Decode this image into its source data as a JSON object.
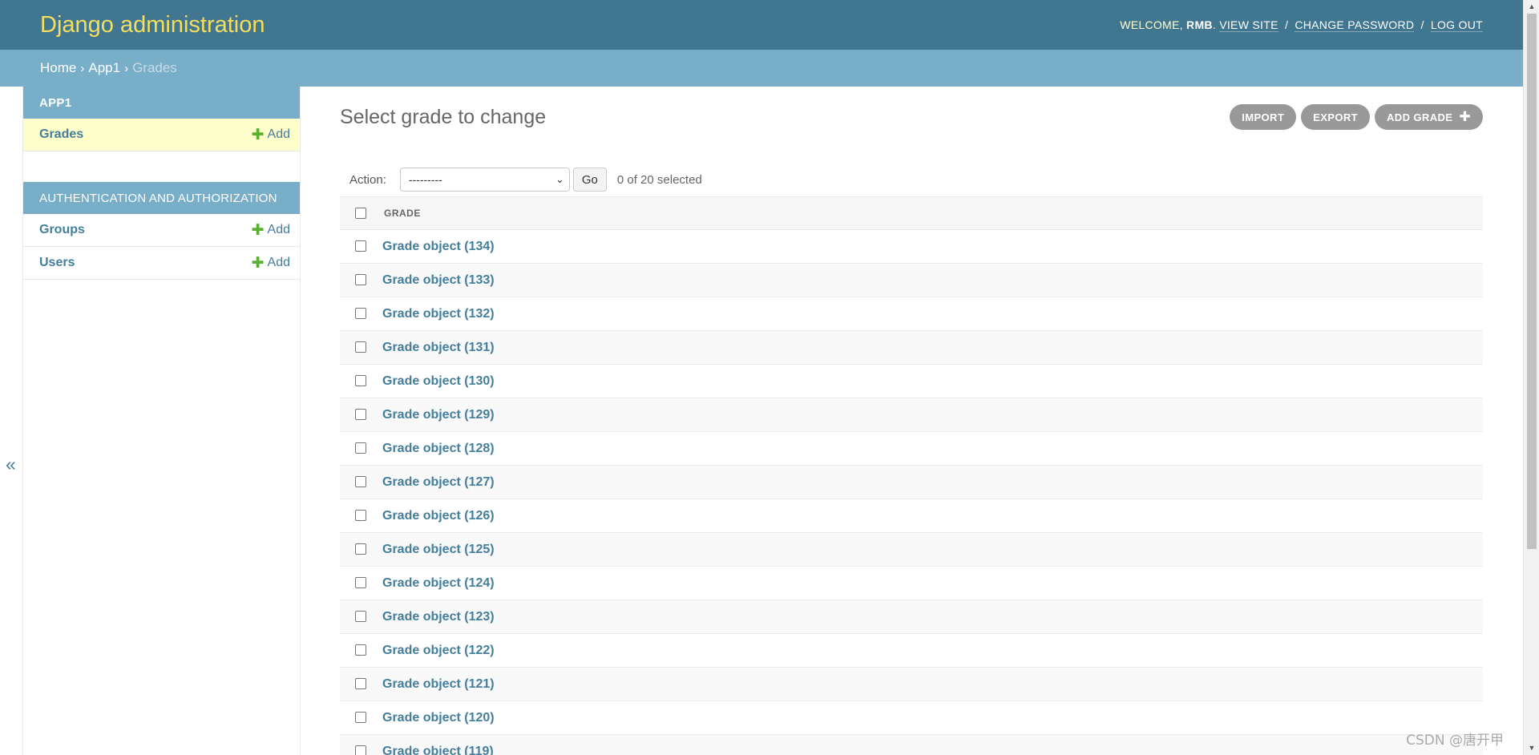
{
  "header": {
    "brand": "Django administration",
    "welcome": "Welcome, ",
    "username": "RMB",
    "period": ". ",
    "view_site": "View site",
    "change_password": "Change password",
    "log_out": "Log out",
    "sep": "/"
  },
  "breadcrumbs": {
    "home": "Home",
    "app": "App1",
    "current": "Grades",
    "sep": "›"
  },
  "nav_toggle": "«",
  "sidebar": {
    "modules": [
      {
        "caption": "App1",
        "models": [
          {
            "name": "Grades",
            "add": "Add"
          }
        ]
      },
      {
        "caption": "Authentication and Authorization",
        "models": [
          {
            "name": "Groups",
            "add": "Add"
          },
          {
            "name": "Users",
            "add": "Add"
          }
        ]
      }
    ]
  },
  "content": {
    "title": "Select grade to change",
    "tools": {
      "import": "Import",
      "export": "Export",
      "add": "Add grade"
    },
    "actions": {
      "label": "Action:",
      "selected_option": "---------",
      "go": "Go",
      "counter": "0 of 20 selected"
    },
    "table": {
      "column": "Grade",
      "rows": [
        "Grade object (134)",
        "Grade object (133)",
        "Grade object (132)",
        "Grade object (131)",
        "Grade object (130)",
        "Grade object (129)",
        "Grade object (128)",
        "Grade object (127)",
        "Grade object (126)",
        "Grade object (125)",
        "Grade object (124)",
        "Grade object (123)",
        "Grade object (122)",
        "Grade object (121)",
        "Grade object (120)",
        "Grade object (119)"
      ]
    }
  },
  "watermark": "CSDN @唐开甲",
  "colors": {
    "header_bg": "#417690",
    "brand": "#f5dd5d",
    "breadcrumb_bg": "#79aec8",
    "link": "#447e9b",
    "add_plus": "#5ab030",
    "active_row": "#ffffcc"
  }
}
